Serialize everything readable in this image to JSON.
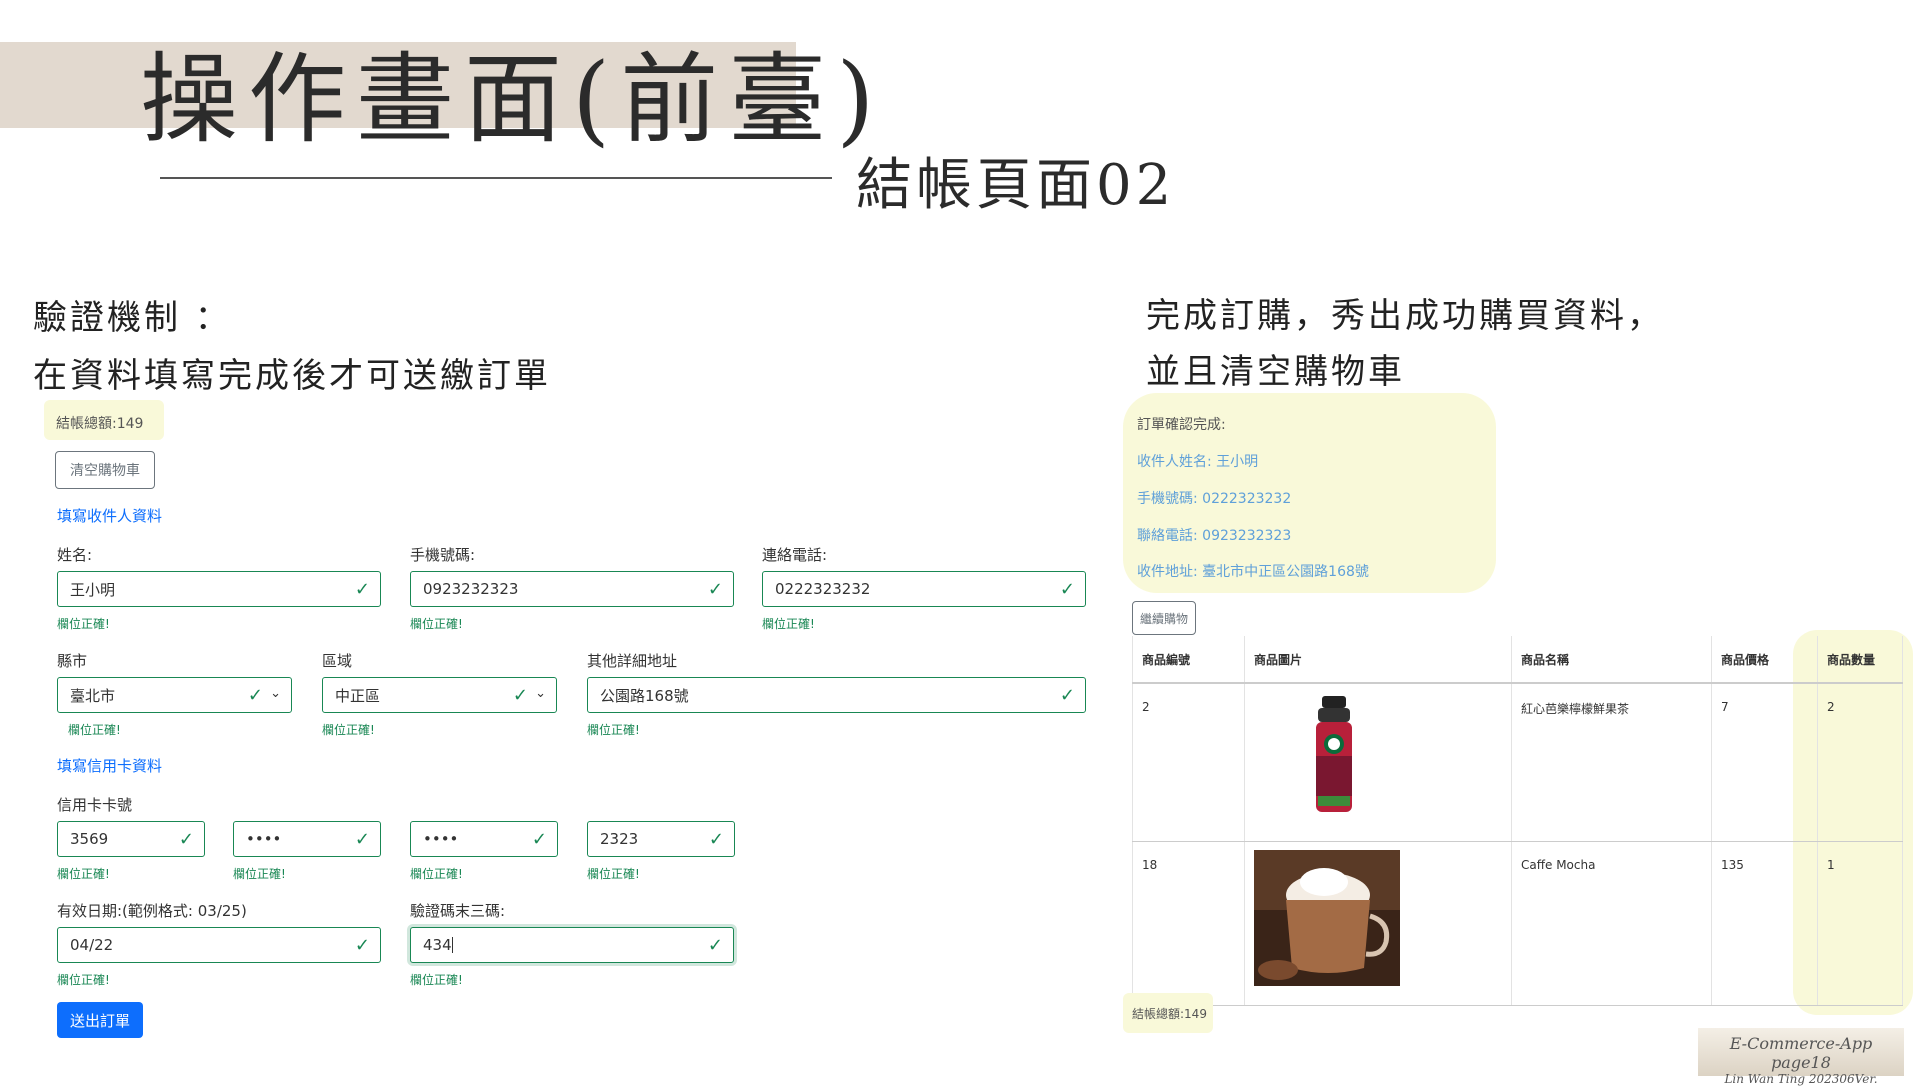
{
  "slide": {
    "title": "操作畫面(前臺)",
    "subtitle": "結帳頁面02",
    "left_note_line1": "驗證機制 ：",
    "left_note_line2": "在資料填寫完成後才可送繳訂單",
    "right_note_line1": "完成訂購，秀出成功購買資料，",
    "right_note_line2": "並且清空購物車",
    "footer_line1": "E-Commerce-App page18",
    "footer_line2": "Lin Wan Ting 202306Ver."
  },
  "checkout_form": {
    "total": "結帳總額:149",
    "clear_cart_label": "清空購物車",
    "recipient_section": "填寫收件人資料",
    "valid_text": "欄位正確!",
    "name_label": "姓名:",
    "name_value": "王小明",
    "mobile_label": "手機號碼:",
    "mobile_value": "0923232323",
    "phone_label": "連絡電話:",
    "phone_value": "0222323232",
    "county_label": "縣市",
    "county_value": "臺北市",
    "district_label": "區域",
    "district_value": "中正區",
    "address_label": "其他詳細地址",
    "address_value": "公園路168號",
    "card_section": "填寫信用卡資料",
    "card_label": "信用卡卡號",
    "card_1": "3569",
    "card_2": "••••",
    "card_3": "••••",
    "card_4": "2323",
    "expiry_label": "有效日期:(範例格式: 03/25)",
    "expiry_value": "04/22",
    "cvv_label": "驗證碼末三碼:",
    "cvv_value": "434",
    "submit_label": "送出訂單"
  },
  "order_confirmation": {
    "heading": "訂單確認完成:",
    "recipient": "收件人姓名: 王小明",
    "mobile": "手機號碼: 0222323232",
    "phone": "聯絡電話: 0923232323",
    "address": "收件地址: 臺北市中正區公園路168號",
    "continue_label": "繼續購物",
    "total": "結帳總額:149"
  },
  "cart_table": {
    "headers": [
      "商品編號",
      "商品圖片",
      "商品名稱",
      "商品價格",
      "商品數量"
    ],
    "rows": [
      {
        "id": "2",
        "name": "紅心芭樂檸檬鮮果茶",
        "price": "7",
        "qty": "2",
        "image": "bottle-drink-image"
      },
      {
        "id": "18",
        "name": "Caffe Mocha",
        "price": "135",
        "qty": "1",
        "image": "mocha-cup-image"
      }
    ]
  },
  "colors": {
    "valid": "#198754",
    "primary": "#0d6efd",
    "highlight": "#f9f9d9",
    "title_band": "#e2d9cf"
  }
}
